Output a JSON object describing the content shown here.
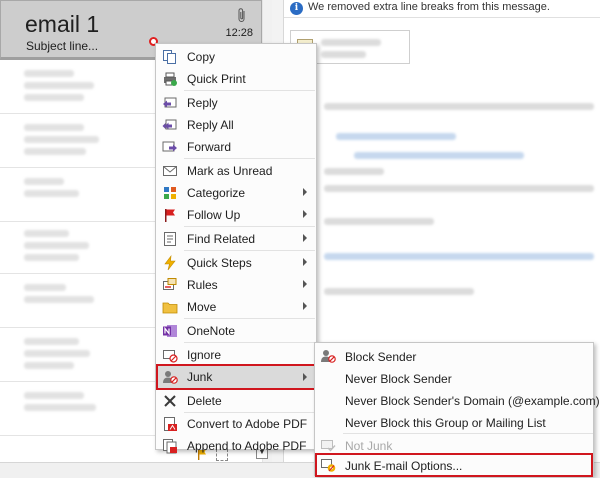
{
  "email_list": {
    "selected_email": {
      "sender": "email 1",
      "subject": "Subject line...",
      "time": "12:28"
    }
  },
  "reading_pane": {
    "info_bar_text": "We removed extra line breaks from this message."
  },
  "context_menu": {
    "items": [
      {
        "label": "Copy",
        "icon": "copy-icon",
        "has_submenu": false
      },
      {
        "label": "Quick Print",
        "icon": "print-icon",
        "has_submenu": false
      },
      {
        "label": "Reply",
        "icon": "reply-icon",
        "has_submenu": false
      },
      {
        "label": "Reply All",
        "icon": "reply-all-icon",
        "has_submenu": false
      },
      {
        "label": "Forward",
        "icon": "forward-icon",
        "has_submenu": false
      },
      {
        "label": "Mark as Unread",
        "icon": "mark-unread-icon",
        "has_submenu": false
      },
      {
        "label": "Categorize",
        "icon": "categorize-icon",
        "has_submenu": true
      },
      {
        "label": "Follow Up",
        "icon": "flag-icon",
        "has_submenu": true
      },
      {
        "label": "Find Related",
        "icon": "find-related-icon",
        "has_submenu": true
      },
      {
        "label": "Quick Steps",
        "icon": "lightning-icon",
        "has_submenu": true
      },
      {
        "label": "Rules",
        "icon": "rules-icon",
        "has_submenu": true
      },
      {
        "label": "Move",
        "icon": "folder-icon",
        "has_submenu": true
      },
      {
        "label": "OneNote",
        "icon": "onenote-icon",
        "has_submenu": false
      },
      {
        "label": "Ignore",
        "icon": "ignore-icon",
        "has_submenu": false
      },
      {
        "label": "Junk",
        "icon": "junk-icon",
        "has_submenu": true
      },
      {
        "label": "Delete",
        "icon": "delete-x-icon",
        "has_submenu": false
      },
      {
        "label": "Convert to Adobe PDF",
        "icon": "adobe-pdf-icon",
        "has_submenu": false
      },
      {
        "label": "Append to Adobe PDF",
        "icon": "adobe-pdf-append-icon",
        "has_submenu": false
      }
    ]
  },
  "junk_submenu": {
    "items": [
      {
        "label": "Block Sender",
        "icon": "block-sender-icon",
        "enabled": true
      },
      {
        "label": "Never Block Sender",
        "icon": "",
        "enabled": true
      },
      {
        "label": "Never Block Sender's Domain (@example.com)",
        "icon": "",
        "enabled": true
      },
      {
        "label": "Never Block this Group or Mailing List",
        "icon": "",
        "enabled": true
      },
      {
        "label": "Not Junk",
        "icon": "not-junk-icon",
        "enabled": false
      },
      {
        "label": "Junk E-mail Options...",
        "icon": "junk-options-icon",
        "enabled": true
      }
    ]
  },
  "colors": {
    "highlight_outline": "#d0161e",
    "selected_row": "#cdcdcd",
    "info_icon": "#2b6cc4"
  }
}
